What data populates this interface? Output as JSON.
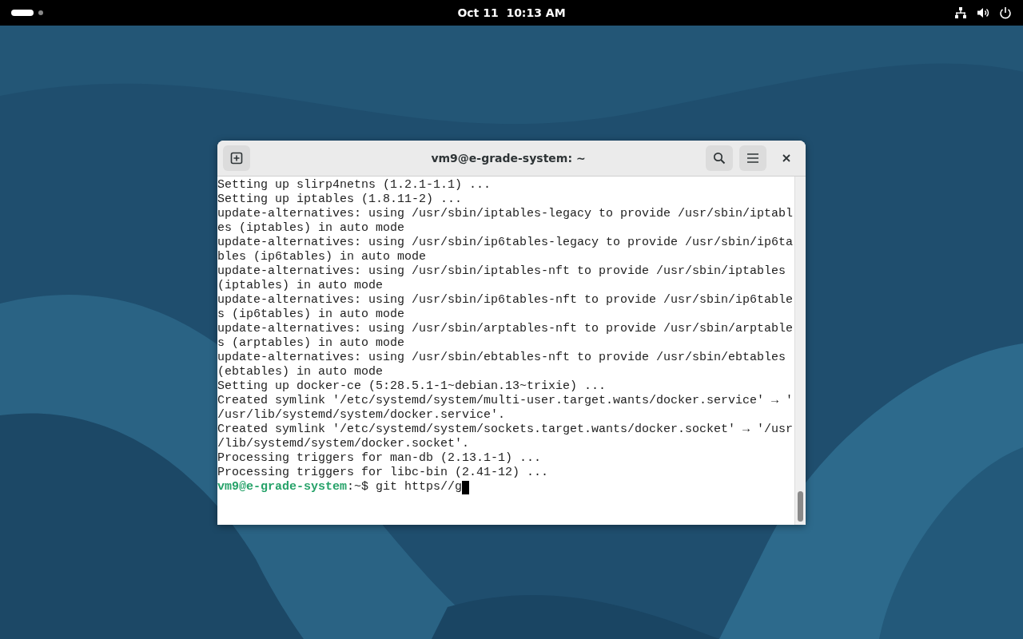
{
  "top_bar": {
    "clock": "Oct 11  10:13 AM"
  },
  "window": {
    "title": "vm9@e-grade-system: ~"
  },
  "terminal": {
    "lines": [
      "Setting up slirp4netns (1.2.1-1.1) ...",
      "Setting up iptables (1.8.11-2) ...",
      "update-alternatives: using /usr/sbin/iptables-legacy to provide /usr/sbin/iptabl",
      "es (iptables) in auto mode",
      "update-alternatives: using /usr/sbin/ip6tables-legacy to provide /usr/sbin/ip6ta",
      "bles (ip6tables) in auto mode",
      "update-alternatives: using /usr/sbin/iptables-nft to provide /usr/sbin/iptables",
      "(iptables) in auto mode",
      "update-alternatives: using /usr/sbin/ip6tables-nft to provide /usr/sbin/ip6table",
      "s (ip6tables) in auto mode",
      "update-alternatives: using /usr/sbin/arptables-nft to provide /usr/sbin/arptable",
      "s (arptables) in auto mode",
      "update-alternatives: using /usr/sbin/ebtables-nft to provide /usr/sbin/ebtables",
      "(ebtables) in auto mode",
      "Setting up docker-ce (5:28.5.1-1~debian.13~trixie) ...",
      "Created symlink '/etc/systemd/system/multi-user.target.wants/docker.service' → '",
      "/usr/lib/systemd/system/docker.service'.",
      "Created symlink '/etc/systemd/system/sockets.target.wants/docker.socket' → '/usr",
      "/lib/systemd/system/docker.socket'.",
      "Processing triggers for man-db (2.13.1-1) ...",
      "Processing triggers for libc-bin (2.41-12) ..."
    ],
    "prompt": {
      "user_host": "vm9@e-grade-system",
      "path": ":~$",
      "command": "git https//g"
    }
  }
}
